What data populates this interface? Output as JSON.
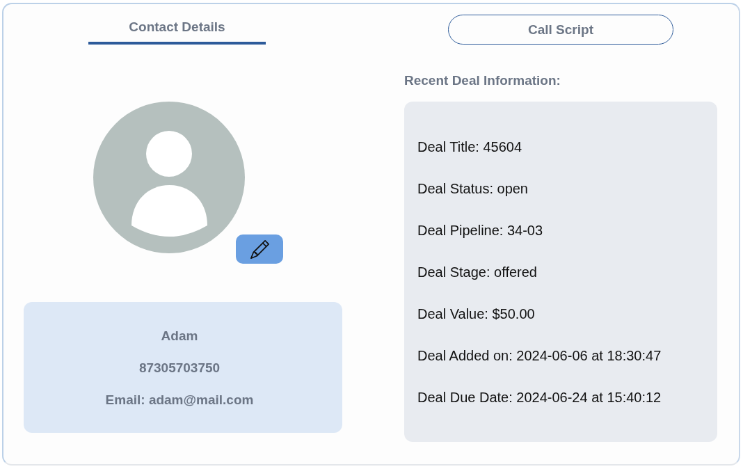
{
  "tabs": [
    {
      "label": "Contact Details",
      "selected": true
    },
    {
      "label": "Call Script",
      "selected": false
    }
  ],
  "contact": {
    "name": "Adam",
    "phone": "87305703750",
    "email": "Email: adam@mail.com"
  },
  "deal": {
    "heading": "Recent Deal Information:",
    "fields": [
      "Deal Title: 45604",
      "Deal Status: open",
      "Deal Pipeline: 34-03",
      "Deal Stage: offered",
      "Deal Value: $50.00",
      "Deal Added on: 2024-06-06 at 18:30:47",
      "Deal Due Date: 2024-06-24 at 15:40:12"
    ]
  }
}
